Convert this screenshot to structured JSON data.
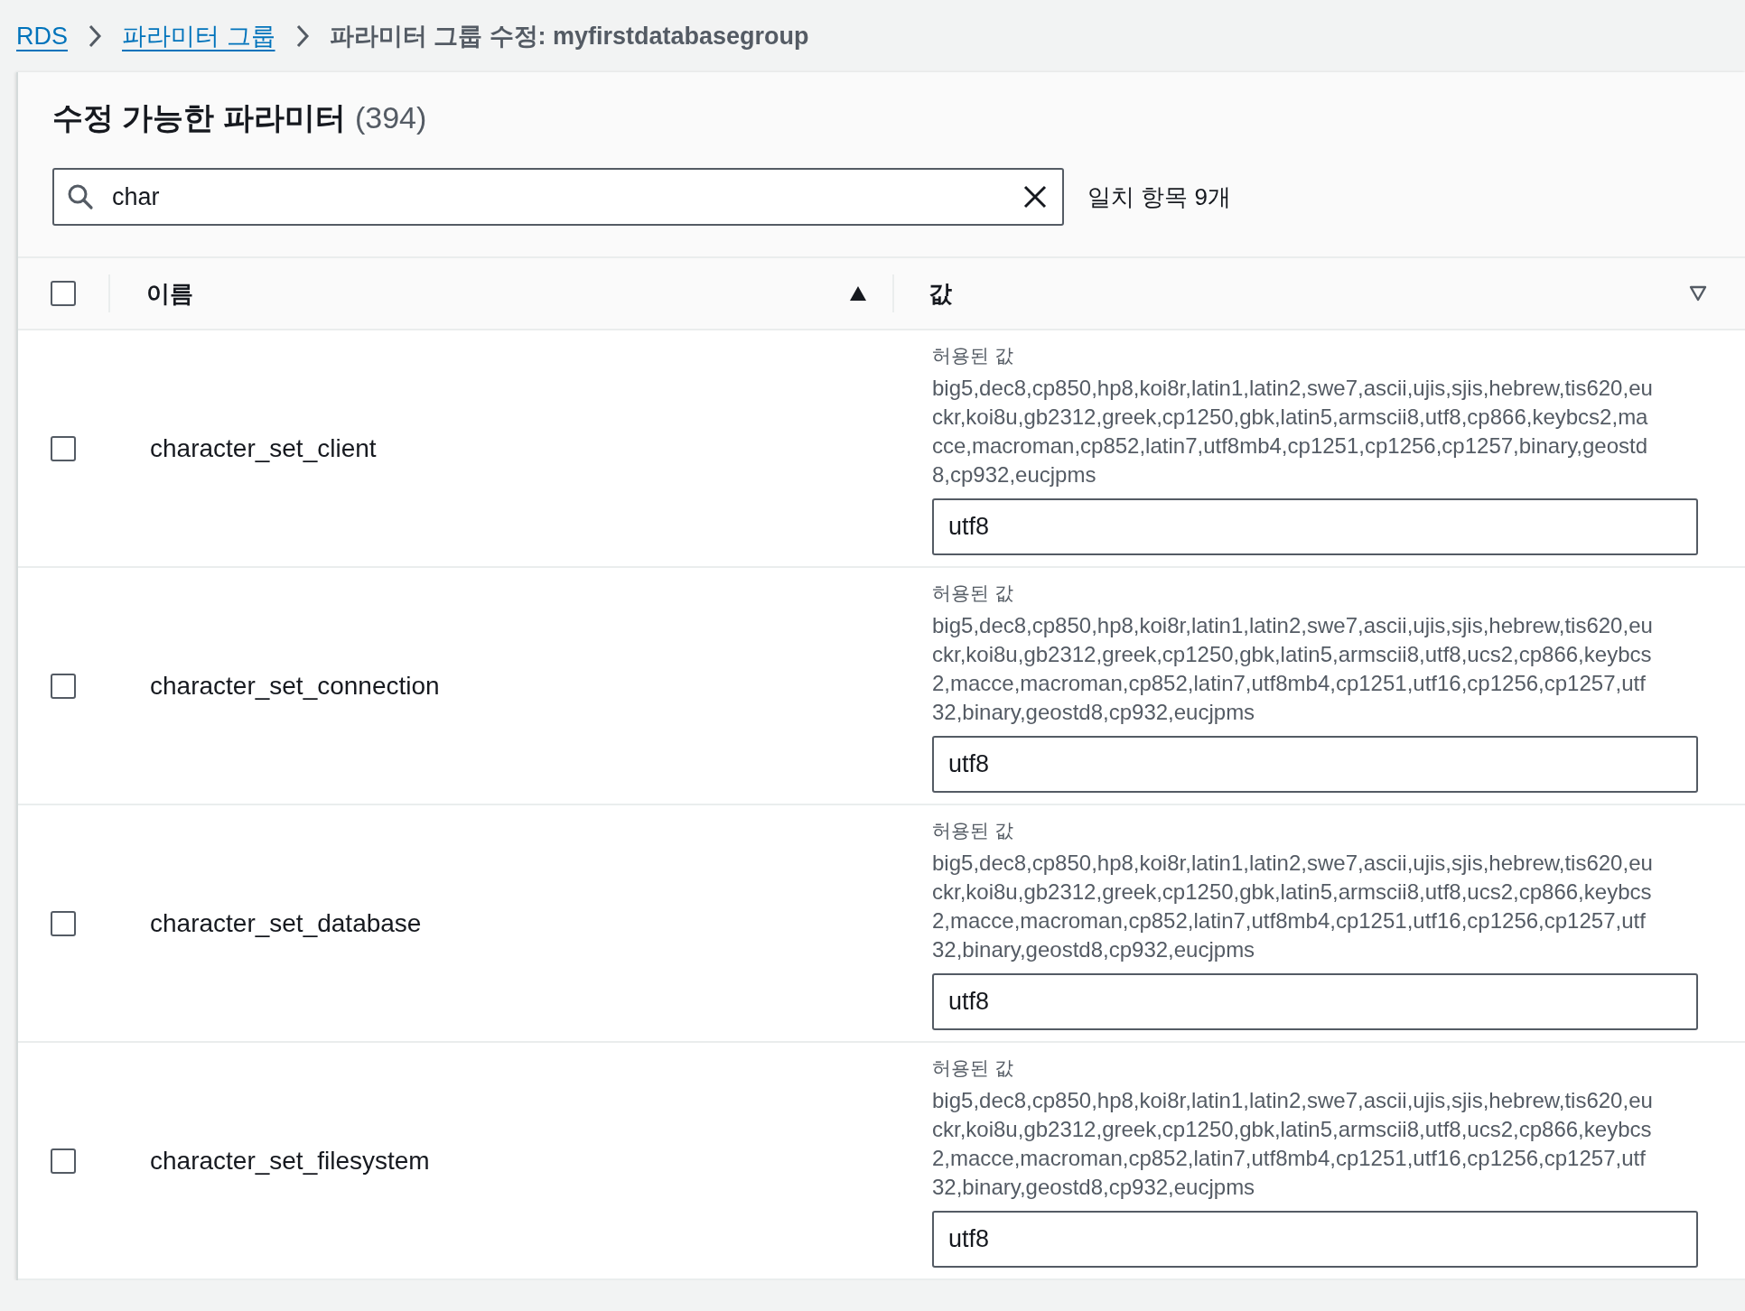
{
  "breadcrumbs": [
    {
      "label": "RDS",
      "kind": "link"
    },
    {
      "label": "파라미터 그룹",
      "kind": "link"
    },
    {
      "label": "파라미터 그룹 수정: myfirstdatabasegroup",
      "kind": "current"
    }
  ],
  "panel": {
    "title": "수정 가능한 파라미터",
    "count": "(394)"
  },
  "search": {
    "value": "char",
    "matches": "일치 항목 9개"
  },
  "table": {
    "select_all": {
      "checked": false
    },
    "columns": [
      {
        "label": "이름",
        "sorted": true
      },
      {
        "label": "값",
        "sorted": false
      }
    ],
    "rows": [
      {
        "checked": false,
        "name": "character_set_client",
        "allowed_label": "허용된 값",
        "allowed_values": "big5,dec8,cp850,hp8,koi8r,latin1,latin2,swe7,ascii,ujis,sjis,hebrew,tis620,euckr,koi8u,gb2312,greek,cp1250,gbk,latin5,armscii8,utf8,cp866,keybcs2,macce,macroman,cp852,latin7,utf8mb4,cp1251,cp1256,cp1257,binary,geostd8,cp932,eucjpms",
        "value": "utf8"
      },
      {
        "checked": false,
        "name": "character_set_connection",
        "allowed_label": "허용된 값",
        "allowed_values": "big5,dec8,cp850,hp8,koi8r,latin1,latin2,swe7,ascii,ujis,sjis,hebrew,tis620,euckr,koi8u,gb2312,greek,cp1250,gbk,latin5,armscii8,utf8,ucs2,cp866,keybcs2,macce,macroman,cp852,latin7,utf8mb4,cp1251,utf16,cp1256,cp1257,utf32,binary,geostd8,cp932,eucjpms",
        "value": "utf8"
      },
      {
        "checked": false,
        "name": "character_set_database",
        "allowed_label": "허용된 값",
        "allowed_values": "big5,dec8,cp850,hp8,koi8r,latin1,latin2,swe7,ascii,ujis,sjis,hebrew,tis620,euckr,koi8u,gb2312,greek,cp1250,gbk,latin5,armscii8,utf8,ucs2,cp866,keybcs2,macce,macroman,cp852,latin7,utf8mb4,cp1251,utf16,cp1256,cp1257,utf32,binary,geostd8,cp932,eucjpms",
        "value": "utf8"
      },
      {
        "checked": false,
        "name": "character_set_filesystem",
        "allowed_label": "허용된 값",
        "allowed_values": "big5,dec8,cp850,hp8,koi8r,latin1,latin2,swe7,ascii,ujis,sjis,hebrew,tis620,euckr,koi8u,gb2312,greek,cp1250,gbk,latin5,armscii8,utf8,ucs2,cp866,keybcs2,macce,macroman,cp852,latin7,utf8mb4,cp1251,utf16,cp1256,cp1257,utf32,binary,geostd8,cp932,eucjpms",
        "value": "utf8"
      }
    ]
  }
}
